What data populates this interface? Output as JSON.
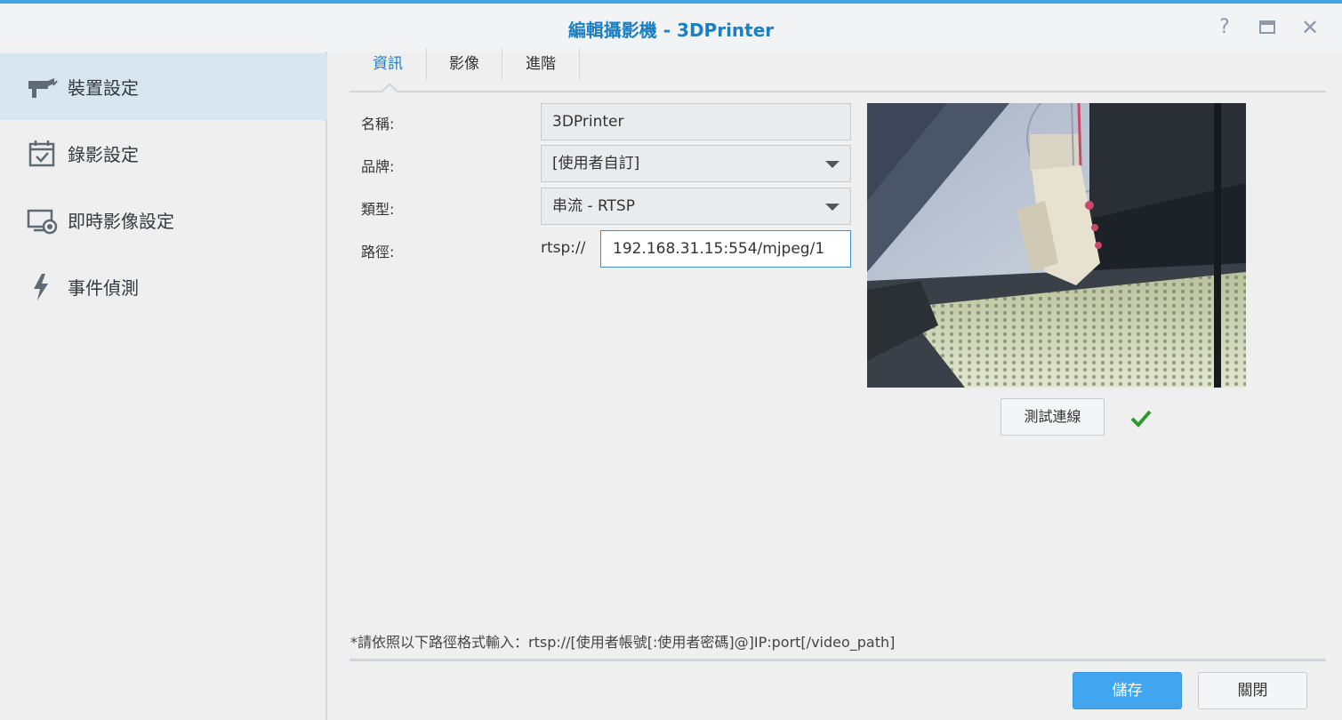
{
  "window": {
    "title": "編輯攝影機 - 3DPrinter",
    "help_icon": "help-icon",
    "maximize_icon": "maximize-icon",
    "close_icon": "close-icon"
  },
  "sidebar": {
    "items": [
      {
        "label": "裝置設定",
        "icon": "camera-icon",
        "active": true
      },
      {
        "label": "錄影設定",
        "icon": "calendar-check-icon",
        "active": false
      },
      {
        "label": "即時影像設定",
        "icon": "live-view-icon",
        "active": false
      },
      {
        "label": "事件偵測",
        "icon": "lightning-icon",
        "active": false
      }
    ]
  },
  "tabs": [
    {
      "label": "資訊",
      "active": true
    },
    {
      "label": "影像",
      "active": false
    },
    {
      "label": "進階",
      "active": false
    }
  ],
  "form": {
    "name_label": "名稱:",
    "name_value": "3DPrinter",
    "brand_label": "品牌:",
    "brand_value": "[使用者自訂]",
    "type_label": "類型:",
    "type_value": "串流 - RTSP",
    "path_label": "路徑:",
    "path_prefix": "rtsp://",
    "path_value": "192.168.31.15:554/mjpeg/1"
  },
  "preview": {
    "test_button": "測試連線",
    "status_icon": "checkmark-icon",
    "status_color": "#2a9a2a"
  },
  "hint": "*請依照以下路徑格式輸入：rtsp://[使用者帳號[:使用者密碼]@]IP:port[/video_path]",
  "footer": {
    "save_label": "儲存",
    "close_label": "關閉"
  },
  "colors": {
    "accent": "#1b7fc4",
    "primary_button": "#42a5ef",
    "sidebar_active": "#d7e6ef"
  }
}
